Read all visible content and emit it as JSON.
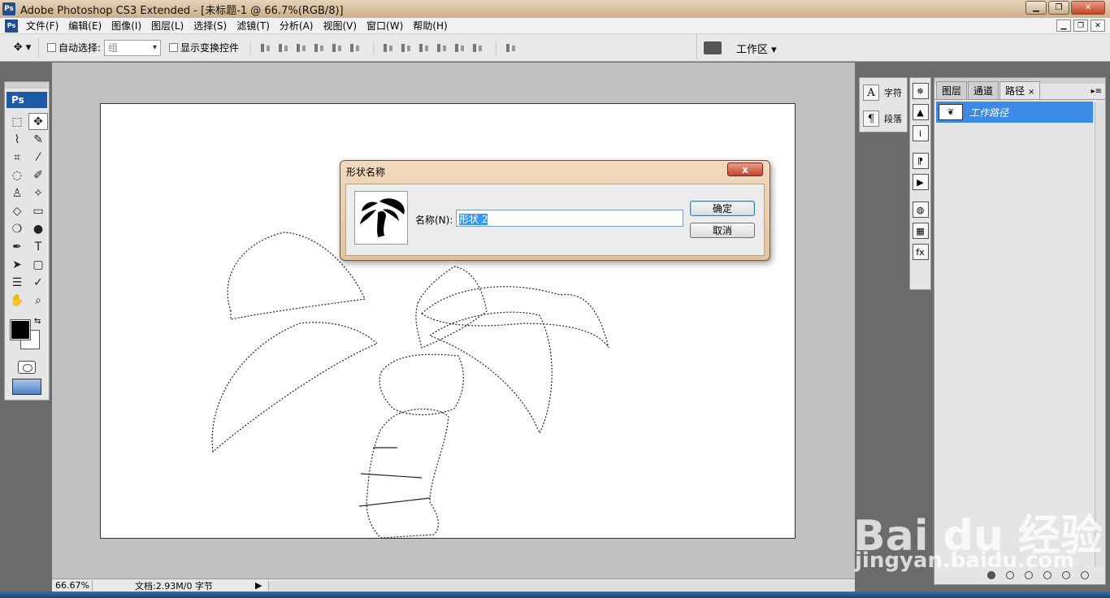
{
  "app": {
    "title": "Adobe Photoshop CS3 Extended - [未标题-1 @ 66.7%(RGB/8)]",
    "logo": "Ps"
  },
  "menu": [
    "文件(F)",
    "编辑(E)",
    "图像(I)",
    "图层(L)",
    "选择(S)",
    "滤镜(T)",
    "分析(A)",
    "视图(V)",
    "窗口(W)",
    "帮助(H)"
  ],
  "options": {
    "auto_select_label": "自动选择:",
    "auto_select_value": "组",
    "show_transform_label": "显示变换控件",
    "workspace_label": "工作区 ▾"
  },
  "toolbox": {
    "badge": "Ps",
    "tools": [
      "⬚",
      "✥",
      "⌇",
      "✎",
      "⌗",
      "⁄",
      "◌",
      "✐",
      "♙",
      "✧",
      "◇",
      "▭",
      "❍",
      "●",
      "✒",
      "T",
      "➤",
      "▢",
      "☰",
      "✓",
      "✋",
      "⌕"
    ]
  },
  "dialog": {
    "title": "形状名称",
    "close": "x",
    "name_label": "名称(N):",
    "name_value": "形状 2",
    "ok": "确定",
    "cancel": "取消"
  },
  "char_panel": {
    "char_label": "字符",
    "para_label": "段落",
    "char_icon": "A",
    "para_icon": "¶"
  },
  "icon_column": [
    "✵",
    "▲",
    "i",
    "⁋",
    "▶",
    "◍",
    "▦",
    "fx"
  ],
  "paths_panel": {
    "tabs": [
      "图层",
      "通道",
      "路径"
    ],
    "active_tab": "路径",
    "tab_close": "×",
    "menu_icon": "▸≡",
    "path_name": "工作路径"
  },
  "status": {
    "zoom": "66.67%",
    "doc_info": "文档:2.93M/0 字节"
  },
  "watermark": {
    "brand": "Bai du 经验",
    "site": "jingyan.baidu.com"
  },
  "colors": {
    "accent": "#3c8ae6",
    "foreground": "#000000",
    "background": "#ffffff"
  }
}
